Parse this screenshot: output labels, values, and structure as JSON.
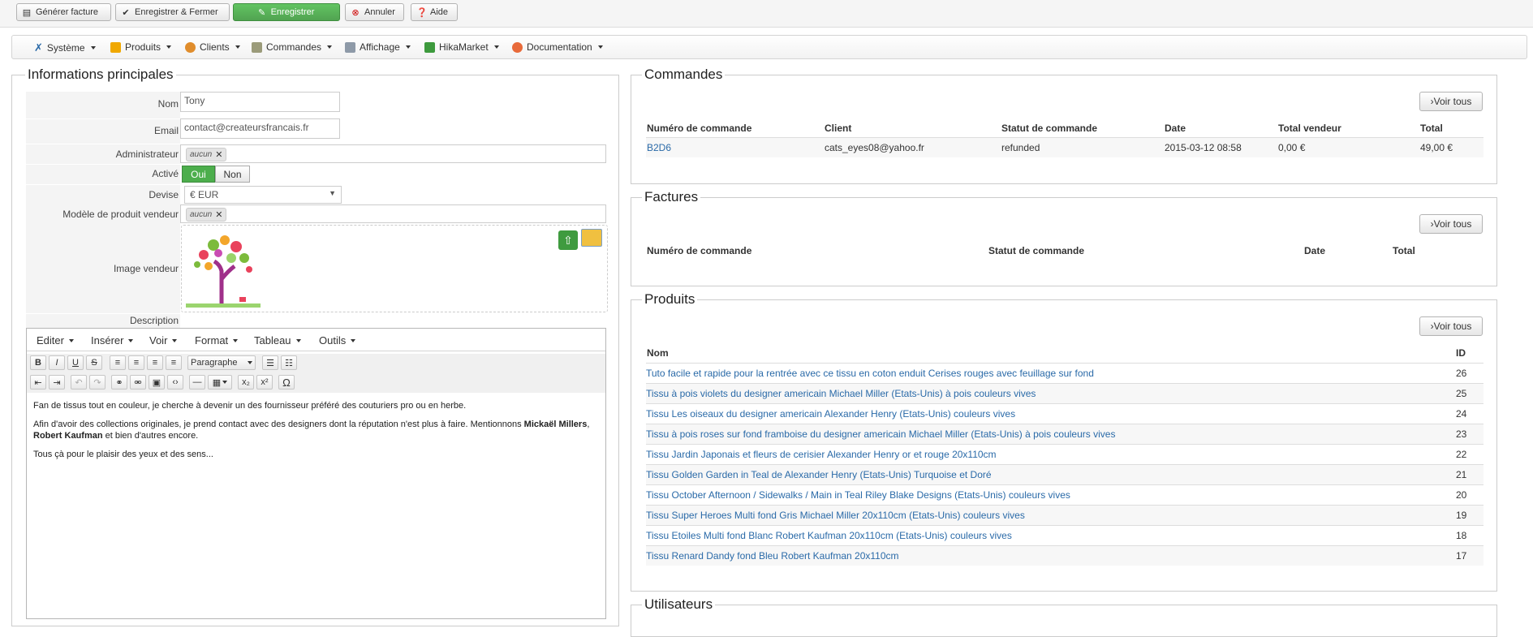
{
  "toolbar": {
    "generate_invoice": "Générer facture",
    "save_close": "Enregistrer & Fermer",
    "save": "Enregistrer",
    "cancel": "Annuler",
    "help": "Aide"
  },
  "menu": {
    "items": [
      "Système",
      "Produits",
      "Clients",
      "Commandes",
      "Affichage",
      "HikaMarket",
      "Documentation"
    ]
  },
  "main_info": {
    "legend": "Informations principales",
    "name_label": "Nom",
    "name_value": "Tony",
    "email_label": "Email",
    "email_value": "contact@createursfrancais.fr",
    "admin_label": "Administrateur",
    "admin_tag": "aucun",
    "active_label": "Activé",
    "yes": "Oui",
    "no": "Non",
    "currency_label": "Devise",
    "currency_value": "€ EUR",
    "template_label": "Modèle de produit vendeur",
    "template_tag": "aucun",
    "image_label": "Image vendeur",
    "description_label": "Description"
  },
  "editor": {
    "menus": [
      "Editer",
      "Insérer",
      "Voir",
      "Format",
      "Tableau",
      "Outils"
    ],
    "paragraph_select": "Paragraphe",
    "p1": "Fan de tissus tout en couleur, je cherche à devenir un des fournisseur préféré des couturiers pro ou en herbe.",
    "p2_a": "Afin d'avoir des collections originales, je prend contact avec des designers dont la réputation n'est plus à faire. Mentionnons ",
    "p2_b": "Mickaël Millers",
    "p2_c": ", ",
    "p2_d": "Robert Kaufman",
    "p2_e": " et bien d'autres encore.",
    "p3": "Tous çà pour le plaisir des yeux et des sens..."
  },
  "orders": {
    "legend": "Commandes",
    "see_all": "Voir tous",
    "headers": [
      "Numéro de commande",
      "Client",
      "Statut de commande",
      "Date",
      "Total vendeur",
      "Total"
    ],
    "rows": [
      {
        "number": "B2D6",
        "client": "cats_eyes08@yahoo.fr",
        "status": "refunded",
        "date": "2015-03-12 08:58",
        "vendor_total": "0,00 €",
        "total": "49,00 €"
      }
    ]
  },
  "invoices": {
    "legend": "Factures",
    "see_all": "Voir tous",
    "headers": [
      "Numéro de commande",
      "Statut de commande",
      "Date",
      "Total"
    ]
  },
  "products": {
    "legend": "Produits",
    "see_all": "Voir tous",
    "headers": [
      "Nom",
      "ID"
    ],
    "rows": [
      {
        "name": "Tuto facile et rapide pour la rentrée avec ce tissu en coton enduit Cerises rouges avec feuillage sur fond",
        "id": "26"
      },
      {
        "name": "Tissu à pois violets du designer americain Michael Miller (Etats-Unis) à pois couleurs vives",
        "id": "25"
      },
      {
        "name": "Tissu Les oiseaux du designer americain Alexander Henry (Etats-Unis) couleurs vives",
        "id": "24"
      },
      {
        "name": "Tissu à pois roses sur fond framboise du designer americain Michael Miller (Etats-Unis) à pois couleurs vives",
        "id": "23"
      },
      {
        "name": "Tissu Jardin Japonais et fleurs de cerisier Alexander Henry or et rouge 20x110cm",
        "id": "22"
      },
      {
        "name": "Tissu Golden Garden in Teal de Alexander Henry (Etats-Unis) Turquoise et Doré",
        "id": "21"
      },
      {
        "name": "Tissu October Afternoon / Sidewalks / Main in Teal Riley Blake Designs (Etats-Unis) couleurs vives",
        "id": "20"
      },
      {
        "name": "Tissu Super Heroes Multi fond Gris Michael Miller 20x110cm (Etats-Unis) couleurs vives",
        "id": "19"
      },
      {
        "name": "Tissu Etoiles Multi fond Blanc Robert Kaufman 20x110cm (Etats-Unis) couleurs vives",
        "id": "18"
      },
      {
        "name": "Tissu Renard Dandy fond Bleu Robert Kaufman 20x110cm",
        "id": "17"
      }
    ]
  },
  "users": {
    "legend": "Utilisateurs"
  }
}
